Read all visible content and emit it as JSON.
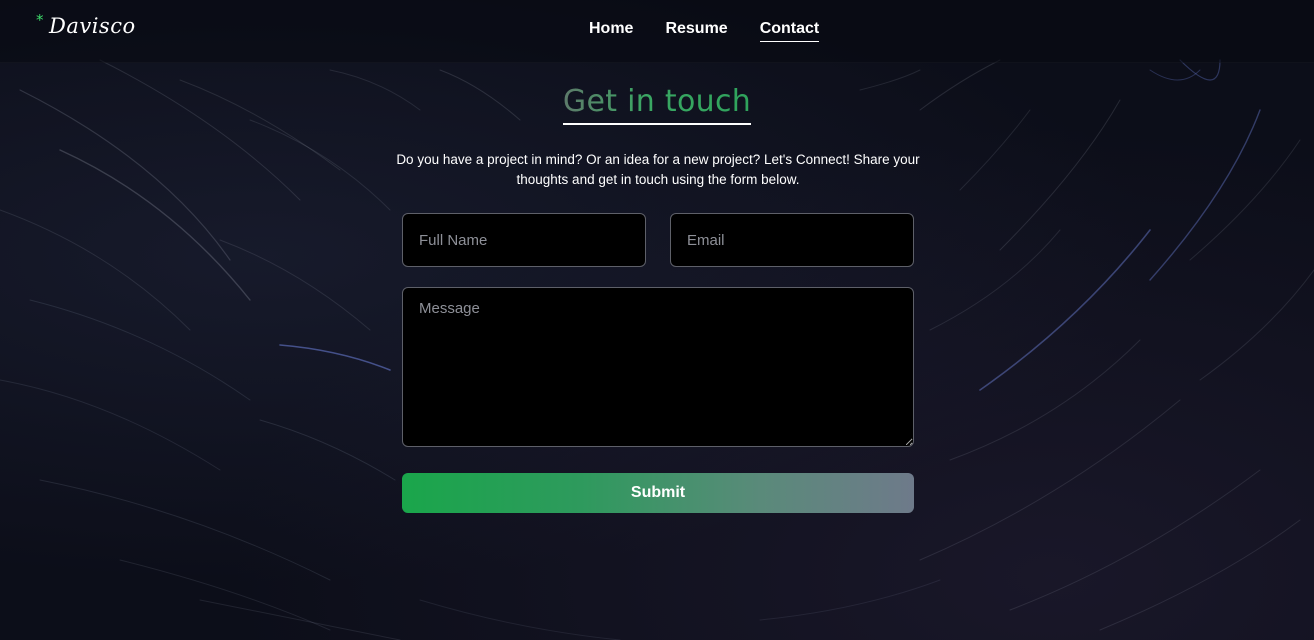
{
  "brand": {
    "star": "*",
    "name": "Davisco",
    "star_color": "#3ddc6a"
  },
  "nav": {
    "items": [
      {
        "label": "Home",
        "active": false
      },
      {
        "label": "Resume",
        "active": false
      },
      {
        "label": "Contact",
        "active": true
      }
    ]
  },
  "contact": {
    "heading": "Get in touch",
    "intro": "Do you have a project in mind? Or an idea for a new project? Let's Connect! Share your thoughts and get in touch using the form below.",
    "full_name": {
      "value": "",
      "placeholder": "Full Name"
    },
    "email": {
      "value": "",
      "placeholder": "Email"
    },
    "message": {
      "value": "",
      "placeholder": "Message"
    },
    "submit_label": "Submit"
  },
  "colors": {
    "accent": "#33a05e",
    "background": "#0c0e19",
    "field_background": "#000000"
  }
}
